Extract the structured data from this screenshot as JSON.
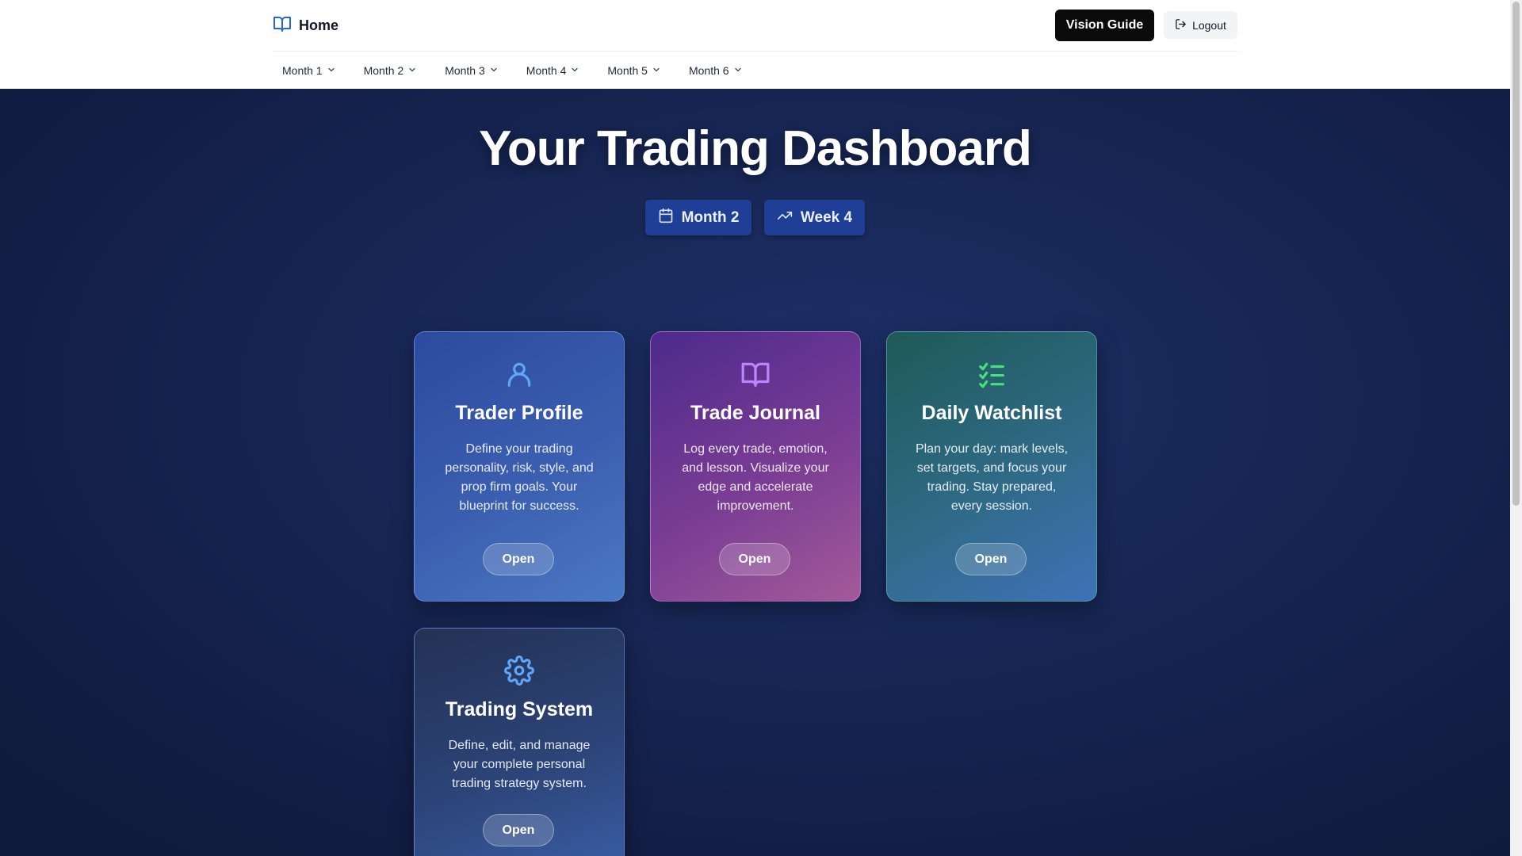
{
  "header": {
    "home_label": "Home",
    "vision_guide_label": "Vision Guide",
    "logout_label": "Logout",
    "months": [
      {
        "label": "Month 1"
      },
      {
        "label": "Month 2"
      },
      {
        "label": "Month 3"
      },
      {
        "label": "Month 4"
      },
      {
        "label": "Month 5"
      },
      {
        "label": "Month 6"
      }
    ]
  },
  "main": {
    "title": "Your Trading Dashboard",
    "current_month": "Month 2",
    "current_week": "Week 4"
  },
  "cards": [
    {
      "title": "Trader Profile",
      "description": "Define your trading personality, risk, style, and prop firm goals. Your blueprint for success.",
      "button": "Open",
      "icon": "user-icon",
      "icon_color": "#60a5fa"
    },
    {
      "title": "Trade Journal",
      "description": "Log every trade, emotion, and lesson. Visualize your edge and accelerate improvement.",
      "button": "Open",
      "icon": "book-open-icon",
      "icon_color": "#c084fc"
    },
    {
      "title": "Daily Watchlist",
      "description": "Plan your day: mark levels, set targets, and focus your trading. Stay prepared, every session.",
      "button": "Open",
      "icon": "list-checks-icon",
      "icon_color": "#4ade80"
    },
    {
      "title": "Trading System",
      "description": "Define, edit, and manage your complete personal trading strategy system.",
      "button": "Open",
      "icon": "gear-icon",
      "icon_color": "#60a5fa"
    }
  ]
}
